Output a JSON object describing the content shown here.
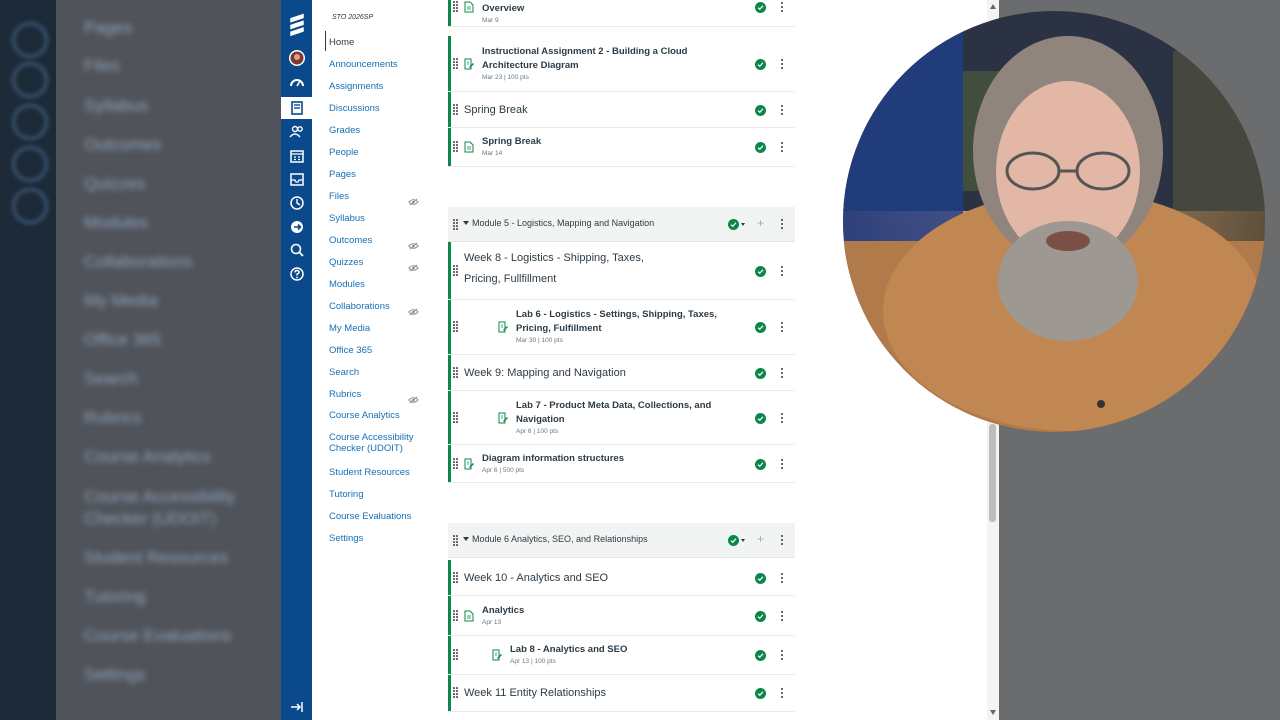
{
  "background_nav": {
    "items": [
      "Pages",
      "Files",
      "Syllabus",
      "Outcomes",
      "Quizzes",
      "Modules",
      "Collaborations",
      "My Media",
      "Office 365",
      "Search",
      "Rubrics",
      "Course Analytics",
      "Course Accessibility Checker (UDOIT)",
      "Student Resources",
      "Tutoring",
      "Course Evaluations",
      "Settings"
    ]
  },
  "global_nav": {
    "icons": [
      "canvas-logo-icon",
      "account-avatar",
      "dashboard-icon",
      "courses-icon",
      "groups-icon",
      "calendar-icon",
      "inbox-icon",
      "history-icon",
      "commons-icon",
      "search-icon",
      "help-icon",
      "collapse-nav-icon"
    ]
  },
  "course_nav": {
    "course_code": "STO 2026SP",
    "items": [
      {
        "label": "Home",
        "active": true,
        "hidden": false
      },
      {
        "label": "Announcements",
        "active": false,
        "hidden": false
      },
      {
        "label": "Assignments",
        "active": false,
        "hidden": false
      },
      {
        "label": "Discussions",
        "active": false,
        "hidden": false
      },
      {
        "label": "Grades",
        "active": false,
        "hidden": false
      },
      {
        "label": "People",
        "active": false,
        "hidden": false
      },
      {
        "label": "Pages",
        "active": false,
        "hidden": false
      },
      {
        "label": "Files",
        "active": false,
        "hidden": true
      },
      {
        "label": "Syllabus",
        "active": false,
        "hidden": false
      },
      {
        "label": "Outcomes",
        "active": false,
        "hidden": true
      },
      {
        "label": "Quizzes",
        "active": false,
        "hidden": true
      },
      {
        "label": "Modules",
        "active": false,
        "hidden": false
      },
      {
        "label": "Collaborations",
        "active": false,
        "hidden": true
      },
      {
        "label": "My Media",
        "active": false,
        "hidden": false
      },
      {
        "label": "Office 365",
        "active": false,
        "hidden": false
      },
      {
        "label": "Search",
        "active": false,
        "hidden": false
      },
      {
        "label": "Rubrics",
        "active": false,
        "hidden": true
      },
      {
        "label": "Course Analytics",
        "active": false,
        "hidden": false
      },
      {
        "label": "Course Accessibility Checker (UDOIT)",
        "active": false,
        "hidden": false
      },
      {
        "label": "Student Resources",
        "active": false,
        "hidden": false
      },
      {
        "label": "Tutoring",
        "active": false,
        "hidden": false
      },
      {
        "label": "Course Evaluations",
        "active": false,
        "hidden": false
      },
      {
        "label": "Settings",
        "active": false,
        "hidden": false
      }
    ]
  },
  "modules": {
    "rows_top": [
      {
        "kind": "item",
        "title": "Introduction to Architecture and Data Structures Overview",
        "meta": "Mar 9",
        "icon": "page-icon"
      },
      {
        "kind": "item",
        "title": "Instructional Assignment 2 - Building a Cloud Architecture Diagram",
        "meta": "Mar 23  |  100 pts",
        "icon": "assignment-icon"
      },
      {
        "kind": "header",
        "title": "Spring Break"
      },
      {
        "kind": "item",
        "title": "Spring Break",
        "meta": "Mar 14",
        "icon": "page-icon"
      }
    ],
    "module5": {
      "title": "Module 5 - Logistics, Mapping and Navigation",
      "rows": [
        {
          "kind": "header",
          "title": "Week 8 - Logistics - Shipping, Taxes, Pricing, Fullfillment"
        },
        {
          "kind": "item",
          "title": "Lab 6 - Logistics - Settings, Shipping, Taxes, Pricing, Fulfillment",
          "meta": "Mar 30  |  100 pts",
          "icon": "assignment-icon"
        },
        {
          "kind": "header",
          "title": "Week 9: Mapping and Navigation"
        },
        {
          "kind": "item",
          "title": "Lab 7 - Product Meta Data, Collections, and Navigation",
          "meta": "Apr 6  |  100 pts",
          "icon": "assignment-icon"
        },
        {
          "kind": "item",
          "title": "Diagram information structures",
          "meta": "Apr 6  |  500 pts",
          "icon": "assignment-icon"
        }
      ]
    },
    "module6": {
      "title": "Module 6 Analytics, SEO, and Relationships",
      "rows": [
        {
          "kind": "header",
          "title": "Week 10 - Analytics and SEO"
        },
        {
          "kind": "item",
          "title": "Analytics",
          "meta": "Apr 13",
          "icon": "page-icon"
        },
        {
          "kind": "item",
          "title": "Lab 8 - Analytics and SEO",
          "meta": "Apr 13  |  100 pts",
          "icon": "assignment-icon"
        },
        {
          "kind": "header",
          "title": "Week 11 Entity Relationships"
        }
      ]
    }
  },
  "colors": {
    "nav_blue": "#0a4a8c",
    "link_blue": "#1570b8",
    "published_green": "#0b874b"
  }
}
